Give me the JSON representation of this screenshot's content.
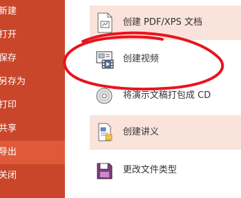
{
  "sidebar": {
    "items": [
      {
        "label": "新建"
      },
      {
        "label": "打开"
      },
      {
        "label": "保存"
      },
      {
        "label": "另存为"
      },
      {
        "label": "打印"
      },
      {
        "label": "共享"
      },
      {
        "label": "导出"
      },
      {
        "label": "关闭"
      }
    ],
    "active_index": 6
  },
  "export_options": [
    {
      "label": "创建 PDF/XPS 文档",
      "icon": "pdf-document-icon"
    },
    {
      "label": "创建视频",
      "icon": "create-video-icon"
    },
    {
      "label": "将演示文稿打包成 CD",
      "icon": "cd-disc-icon"
    },
    {
      "label": "创建讲义",
      "icon": "handout-icon"
    },
    {
      "label": "更改文件类型",
      "icon": "change-file-type-icon"
    }
  ],
  "colors": {
    "sidebar": "#c9462a",
    "sidebar_active": "#e05a3a",
    "option_highlight": "#f9e3db",
    "annotation_red": "#e8141e"
  }
}
